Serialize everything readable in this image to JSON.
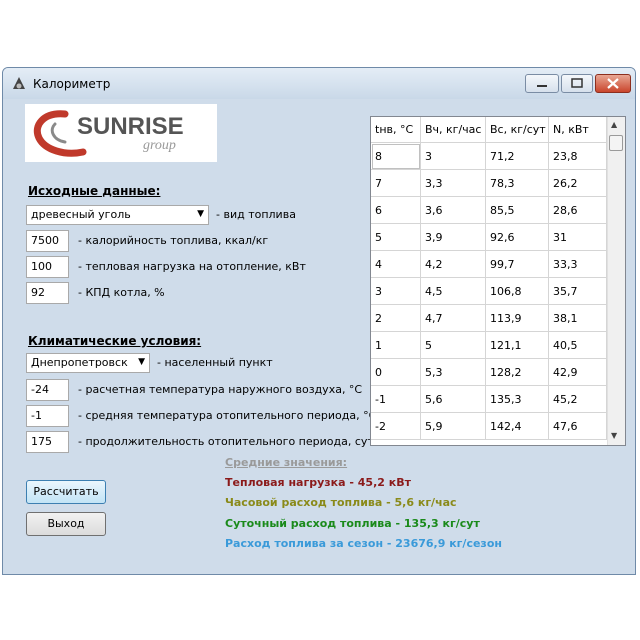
{
  "window": {
    "title": "Калориметр"
  },
  "logo": {
    "text": "SUNRISE",
    "sub": "group"
  },
  "source": {
    "heading": "Исходные данные:",
    "fuel_value": "древесный уголь",
    "fuel_label": "- вид топлива",
    "calorific_value": "7500",
    "calorific_label": "- калорийность топлива, ккал/кг",
    "heat_load_value": "100",
    "heat_load_label": "- тепловая нагрузка на отопление, кВт",
    "efficiency_value": "92",
    "efficiency_label": "- КПД котла, %"
  },
  "climate": {
    "heading": "Климатические условия:",
    "city_value": "Днепропетровск",
    "city_label": "- населенный пункт",
    "design_temp_value": "-24",
    "design_temp_label": "- расчетная температура наружного воздуха, °С",
    "avg_temp_value": "-1",
    "avg_temp_label": "- средняя температура отопительного периода, °С",
    "duration_value": "175",
    "duration_label": "- продолжительность отопительного периода, сут"
  },
  "buttons": {
    "calculate": "Рассчитать",
    "exit": "Выход"
  },
  "table": {
    "columns": [
      "tнв, °С",
      "Вч, кг/час",
      "Вс, кг/сут",
      "N, кВт"
    ],
    "rows": [
      [
        "8",
        "3",
        "71,2",
        "23,8"
      ],
      [
        "7",
        "3,3",
        "78,3",
        "26,2"
      ],
      [
        "6",
        "3,6",
        "85,5",
        "28,6"
      ],
      [
        "5",
        "3,9",
        "92,6",
        "31"
      ],
      [
        "4",
        "4,2",
        "99,7",
        "33,3"
      ],
      [
        "3",
        "4,5",
        "106,8",
        "35,7"
      ],
      [
        "2",
        "4,7",
        "113,9",
        "38,1"
      ],
      [
        "1",
        "5",
        "121,1",
        "40,5"
      ],
      [
        "0",
        "5,3",
        "128,2",
        "42,9"
      ],
      [
        "-1",
        "5,6",
        "135,3",
        "45,2"
      ],
      [
        "-2",
        "5,9",
        "142,4",
        "47,6"
      ]
    ]
  },
  "averages": {
    "heading": "Средние значения:",
    "heat_load": "Тепловая нагрузка - 45,2 кВт",
    "hourly": "Часовой расход топлива - 5,6 кг/час",
    "daily": "Суточный расход топлива - 135,3 кг/сут",
    "season": "Расход топлива за сезон - 23676,9 кг/сезон"
  },
  "colors": {
    "heat_load": "#8b1a1a",
    "hourly": "#8a8a1a",
    "daily": "#1a8a1a",
    "season": "#3a9ad9",
    "logo_red": "#c0392b"
  }
}
